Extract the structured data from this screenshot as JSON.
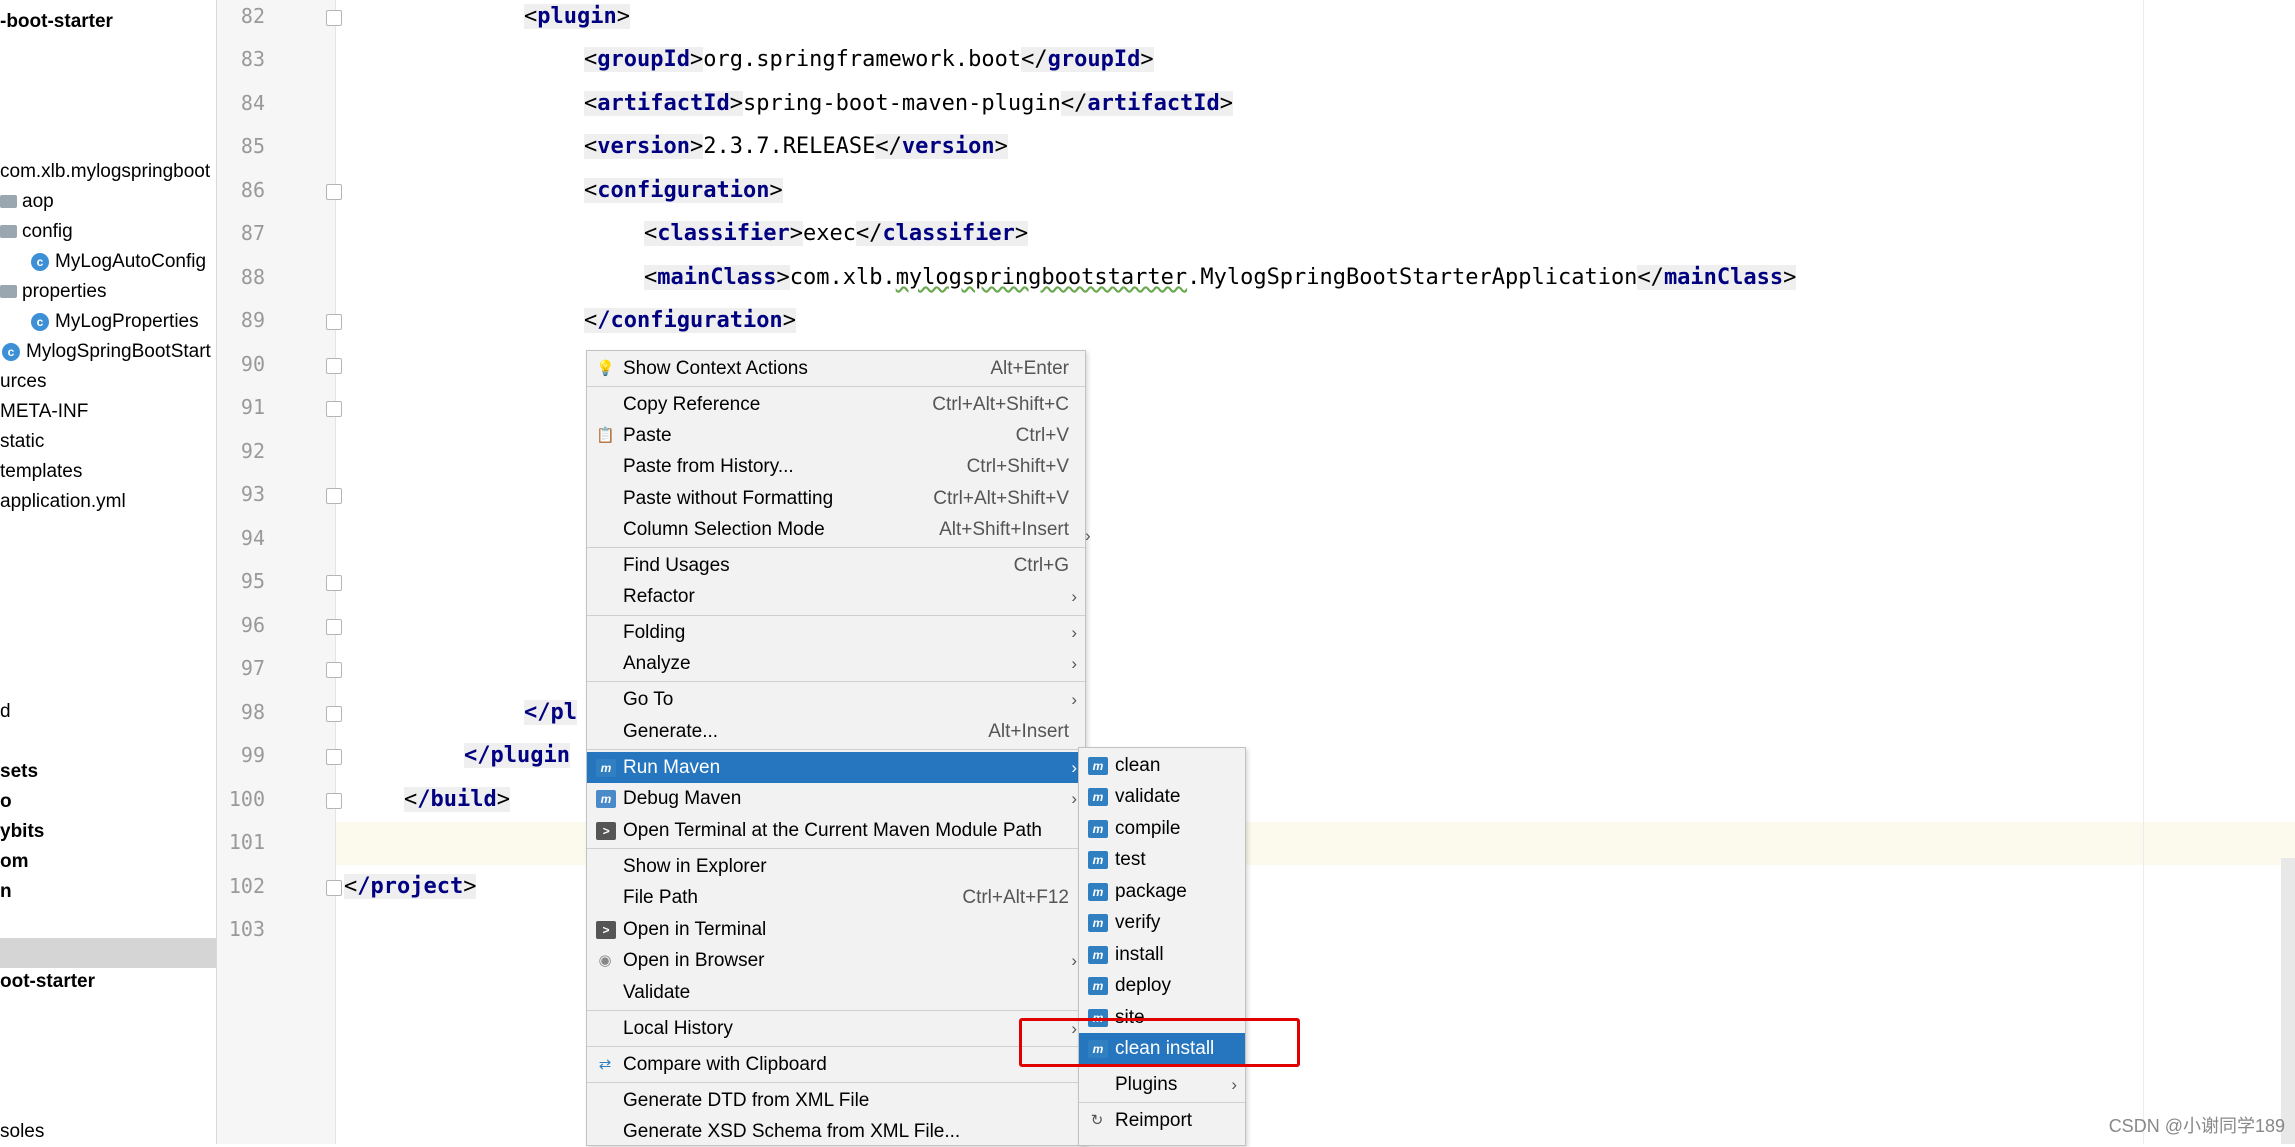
{
  "tree": {
    "items": [
      {
        "label": "-boot-starter",
        "bold": true,
        "icon": ""
      },
      {
        "label": "com.xlb.mylogspringboot",
        "bold": false,
        "icon": ""
      },
      {
        "label": "aop",
        "bold": false,
        "icon": "folder-icon"
      },
      {
        "label": "config",
        "bold": false,
        "icon": "folder-icon"
      },
      {
        "label": "MyLogAutoConfig",
        "bold": false,
        "icon": "class-icon"
      },
      {
        "label": "properties",
        "bold": false,
        "icon": "folder-icon"
      },
      {
        "label": "MyLogProperties",
        "bold": false,
        "icon": "class-icon"
      },
      {
        "label": "MylogSpringBootStart",
        "bold": false,
        "icon": "class-icon"
      },
      {
        "label": "urces",
        "bold": false,
        "icon": ""
      },
      {
        "label": "META-INF",
        "bold": false,
        "icon": ""
      },
      {
        "label": "static",
        "bold": false,
        "icon": ""
      },
      {
        "label": "templates",
        "bold": false,
        "icon": ""
      },
      {
        "label": "application.yml",
        "bold": false,
        "icon": ""
      },
      {
        "label": "d",
        "bold": false,
        "icon": ""
      },
      {
        "label": "sets",
        "bold": true,
        "icon": ""
      },
      {
        "label": "o",
        "bold": true,
        "icon": ""
      },
      {
        "label": "ybits",
        "bold": true,
        "icon": ""
      },
      {
        "label": "om",
        "bold": true,
        "icon": ""
      },
      {
        "label": "n",
        "bold": true,
        "icon": ""
      },
      {
        "label": "oot-starter",
        "bold": true,
        "icon": ""
      },
      {
        "label": "soles",
        "bold": false,
        "icon": ""
      }
    ]
  },
  "gutter": {
    "line_numbers": [
      "82",
      "83",
      "84",
      "85",
      "86",
      "87",
      "88",
      "89",
      "90",
      "91",
      "92",
      "93",
      "94",
      "95",
      "96",
      "97",
      "98",
      "99",
      "100",
      "101",
      "102",
      "103"
    ]
  },
  "code": {
    "l82_tag": "plugin",
    "l83_open": "groupId",
    "l83_text": "org.springframework.boot",
    "l83_close": "groupId",
    "l84_open": "artifactId",
    "l84_text": "spring-boot-maven-plugin",
    "l84_close": "artifactId",
    "l85_open": "version",
    "l85_text": "2.3.7.RELEASE",
    "l85_close": "version",
    "l86_tag": "configuration",
    "l87_open": "classifier",
    "l87_text": "exec",
    "l87_close": "classifier",
    "l88_open": "mainClass",
    "l88_text1": "com.xlb.",
    "l88_text2": "mylogspringbootstarter",
    "l88_text3": ".MylogSpringBootStarterApplication",
    "l88_close": "mainClass",
    "l89_tag": "/configuration",
    "l98_text": "</pl",
    "l99_text": "</plugin",
    "l100_tag": "/build",
    "l102_tag": "/project"
  },
  "context_menu": {
    "items": [
      {
        "label": "Show Context Actions",
        "shortcut": "Alt+Enter",
        "icon": "lightbulb-icon"
      },
      {
        "label": "Copy Reference",
        "shortcut": "Ctrl+Alt+Shift+C",
        "icon": ""
      },
      {
        "label": "Paste",
        "shortcut": "Ctrl+V",
        "icon": "clipboard-icon"
      },
      {
        "label": "Paste from History...",
        "shortcut": "Ctrl+Shift+V",
        "icon": ""
      },
      {
        "label": "Paste without Formatting",
        "shortcut": "Ctrl+Alt+Shift+V",
        "icon": ""
      },
      {
        "label": "Column Selection Mode",
        "shortcut": "Alt+Shift+Insert",
        "icon": ""
      },
      {
        "label": "Find Usages",
        "shortcut": "Ctrl+G",
        "icon": ""
      },
      {
        "label": "Refactor",
        "shortcut": "",
        "icon": "",
        "submenu": true
      },
      {
        "label": "Folding",
        "shortcut": "",
        "icon": "",
        "submenu": true
      },
      {
        "label": "Analyze",
        "shortcut": "",
        "icon": "",
        "submenu": true
      },
      {
        "label": "Go To",
        "shortcut": "",
        "icon": "",
        "submenu": true
      },
      {
        "label": "Generate...",
        "shortcut": "Alt+Insert",
        "icon": ""
      },
      {
        "label": "Run Maven",
        "shortcut": "",
        "icon": "maven-run-icon",
        "submenu": true,
        "selected": true
      },
      {
        "label": "Debug Maven",
        "shortcut": "",
        "icon": "maven-debug-icon",
        "submenu": true
      },
      {
        "label": "Open Terminal at the Current Maven Module Path",
        "shortcut": "",
        "icon": "terminal-maven-icon"
      },
      {
        "label": "Show in Explorer",
        "shortcut": "",
        "icon": ""
      },
      {
        "label": "File Path",
        "shortcut": "Ctrl+Alt+F12",
        "icon": ""
      },
      {
        "label": "Open in Terminal",
        "shortcut": "",
        "icon": "terminal-icon"
      },
      {
        "label": "Open in Browser",
        "shortcut": "",
        "icon": "globe-icon",
        "submenu": true
      },
      {
        "label": "Validate",
        "shortcut": "",
        "icon": ""
      },
      {
        "label": "Local History",
        "shortcut": "",
        "icon": "",
        "submenu": true
      },
      {
        "label": "Compare with Clipboard",
        "shortcut": "",
        "icon": "compare-icon"
      },
      {
        "label": "Generate DTD from XML File",
        "shortcut": "",
        "icon": ""
      },
      {
        "label": "Generate XSD Schema from XML File...",
        "shortcut": "",
        "icon": ""
      }
    ]
  },
  "submenu": {
    "items": [
      {
        "label": "clean",
        "icon": "maven-goal-icon"
      },
      {
        "label": "validate",
        "icon": "maven-goal-icon"
      },
      {
        "label": "compile",
        "icon": "maven-goal-icon"
      },
      {
        "label": "test",
        "icon": "maven-goal-icon"
      },
      {
        "label": "package",
        "icon": "maven-goal-icon"
      },
      {
        "label": "verify",
        "icon": "maven-goal-icon"
      },
      {
        "label": "install",
        "icon": "maven-goal-icon"
      },
      {
        "label": "deploy",
        "icon": "maven-goal-icon"
      },
      {
        "label": "site",
        "icon": "maven-goal-icon"
      },
      {
        "label": "clean install",
        "icon": "maven-goal-icon",
        "selected": true
      },
      {
        "label": "Plugins",
        "icon": "",
        "submenu": true
      },
      {
        "label": "Reimport",
        "icon": "reload-icon"
      }
    ]
  },
  "watermark": "CSDN @小谢同学189",
  "colors": {
    "selection": "#2675bf",
    "highlight_box": "#e00000",
    "tag": "#000080"
  }
}
